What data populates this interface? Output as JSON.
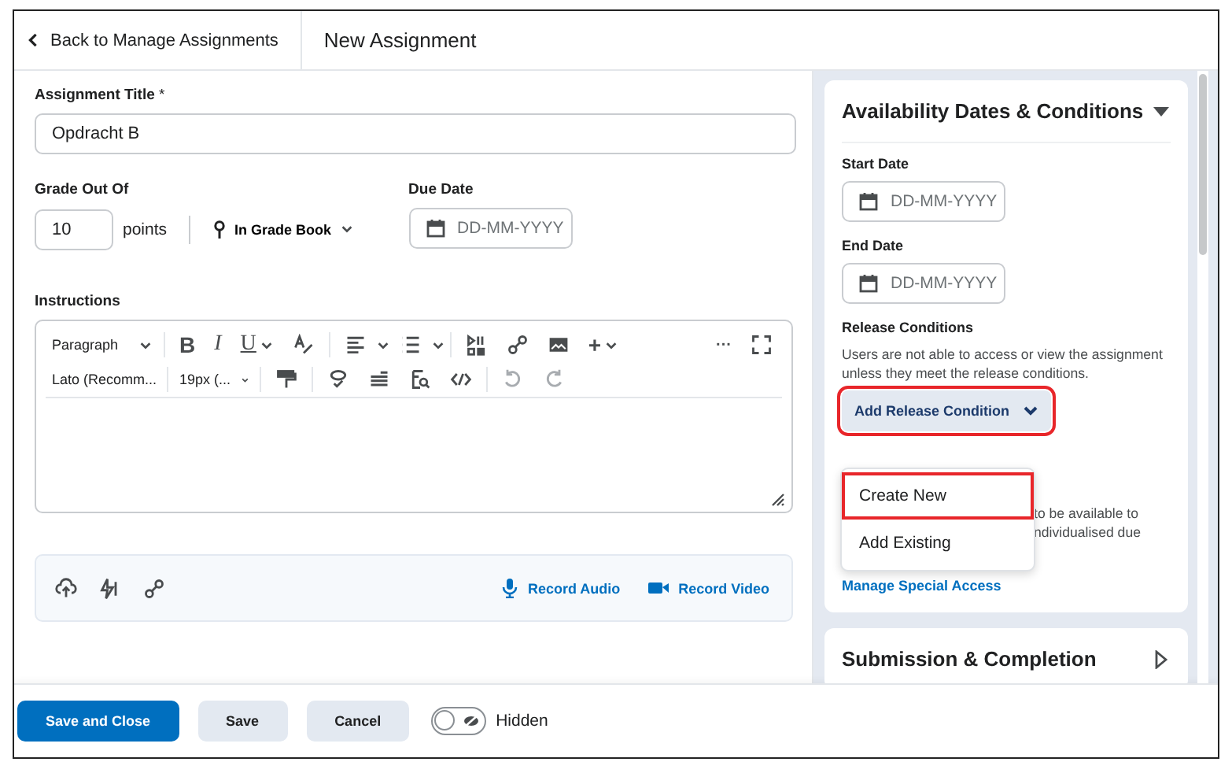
{
  "header": {
    "back_link": "Back to Manage Assignments",
    "title": "New Assignment"
  },
  "form": {
    "title_label": "Assignment Title",
    "required_mark": "*",
    "title_value": "Opdracht B",
    "grade_label": "Grade Out Of",
    "grade_value": "10",
    "grade_unit": "points",
    "grade_book": "In Grade Book",
    "due_label": "Due Date",
    "due_placeholder": "DD-MM-YYYY",
    "instructions_label": "Instructions",
    "editor": {
      "format": "Paragraph",
      "bold": "B",
      "italic": "I",
      "underline": "U",
      "insert": "+",
      "more": "···",
      "font": "Lato (Recomm...",
      "size": "19px (..."
    },
    "attach": {
      "record_audio": "Record Audio",
      "record_video": "Record Video"
    }
  },
  "sidebar": {
    "sections": [
      {
        "title": "Availability Dates & Conditions",
        "expanded": true
      },
      {
        "title": "Submission & Completion",
        "expanded": false
      }
    ],
    "start_label": "Start Date",
    "start_placeholder": "DD-MM-YYYY",
    "end_label": "End Date",
    "end_placeholder": "DD-MM-YYYY",
    "release_label": "Release Conditions",
    "release_text": "Users are not able to access or view the assignment unless they meet the release conditions.",
    "add_release": {
      "label": "Add Release Condition",
      "expanded": true,
      "highlighted": true
    },
    "menu": [
      {
        "label": "Create New",
        "highlighted": true
      },
      {
        "label": "Add Existing",
        "highlighted": false
      }
    ],
    "covered_text": [
      "to be available to",
      "ndividualised due"
    ],
    "special_access_link": "Manage Special Access"
  },
  "footer": {
    "buttons": [
      {
        "label": "Save and Close",
        "kind": "primary"
      },
      {
        "label": "Save",
        "kind": "secondary"
      },
      {
        "label": "Cancel",
        "kind": "secondary"
      }
    ],
    "visibility": {
      "label": "Hidden",
      "on": false
    }
  }
}
